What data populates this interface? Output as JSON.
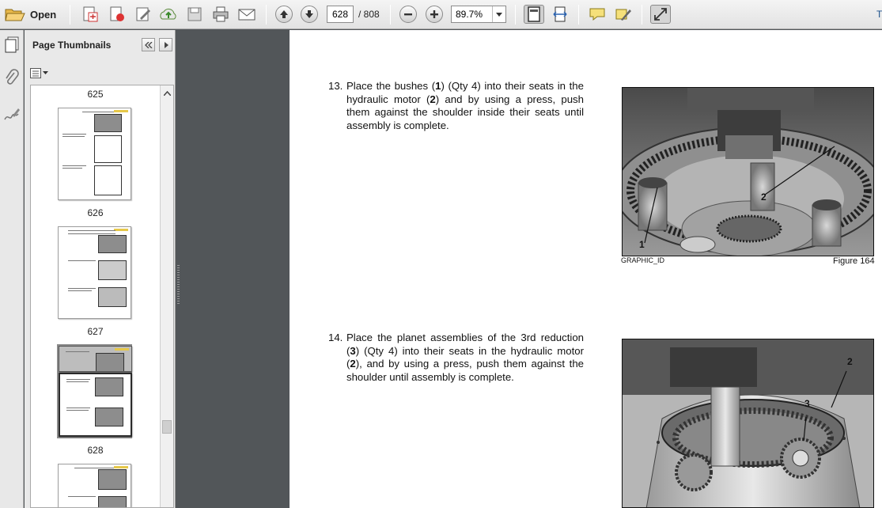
{
  "toolbar": {
    "open_label": "Open",
    "current_page": "628",
    "page_total": "/ 808",
    "zoom": "89.7%",
    "cut_text": "T",
    "icons": [
      "folder-open-icon",
      "create-pdf-icon",
      "print-pdf-icon",
      "edit-icon",
      "upload-icon",
      "save-icon",
      "print-icon",
      "email-icon",
      "previous-page-icon",
      "next-page-icon",
      "zoom-out-icon",
      "zoom-in-icon",
      "zoom-dropdown-icon",
      "fit-page-icon",
      "fit-width-icon",
      "comment-icon",
      "highlight-icon",
      "expand-icon"
    ]
  },
  "navstrip": {
    "icons": [
      "page-thumbnails-icon",
      "attachments-icon",
      "signatures-icon"
    ]
  },
  "thumbnails": {
    "title": "Page Thumbnails",
    "labels": [
      "625",
      "626",
      "627",
      "628"
    ]
  },
  "document": {
    "step13": {
      "num": "13.",
      "parts": [
        "Place the bushes (",
        "1",
        ") (Qty 4) into their seats in the hydraulic motor (",
        "2",
        ") and by using a press, push them against the shoulder inside their seats until assembly is complete."
      ]
    },
    "step14": {
      "num": "14.",
      "parts": [
        "Place the planet assemblies of the 3rd reduction (",
        "3",
        ") (Qty 4) into their seats in the hydraulic motor (",
        "2",
        "), and by using a press, push them against the shoulder until assembly is complete."
      ]
    },
    "figure1": {
      "callout_1": "1",
      "callout_2": "2",
      "graphic_id": "GRAPHIC_ID",
      "figure": "Figure 164"
    },
    "figure2": {
      "callout_2": "2",
      "callout_3": "3"
    }
  }
}
